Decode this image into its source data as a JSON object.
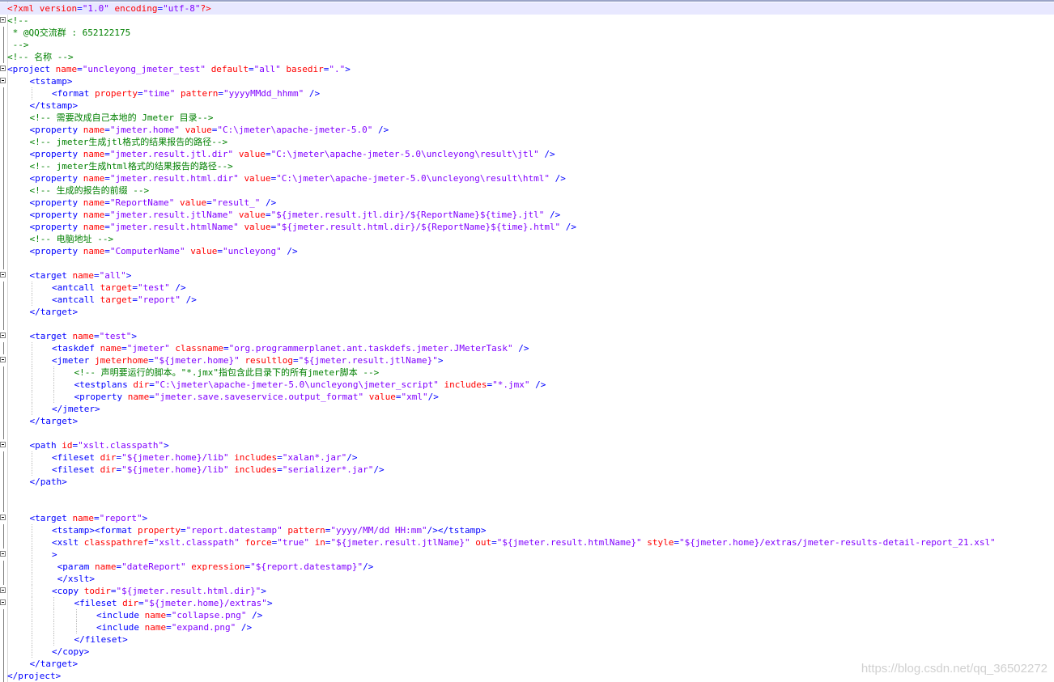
{
  "watermark": "https://blog.csdn.net/qq_36502272",
  "colors": {
    "tag": "#0000ff",
    "attr": "#ff0000",
    "value": "#8000ff",
    "comment": "#008000",
    "current_line": "#e8e8ff"
  },
  "lines": [
    {
      "indent": 0,
      "fold": false,
      "current": true,
      "tokens": [
        [
          "pi",
          "<?xml "
        ],
        [
          "attr",
          "version"
        ],
        [
          "tag",
          "="
        ],
        [
          "val",
          "\"1.0\""
        ],
        [
          "pi",
          " "
        ],
        [
          "attr",
          "encoding"
        ],
        [
          "tag",
          "="
        ],
        [
          "val",
          "\"utf-8\""
        ],
        [
          "pi",
          "?>"
        ]
      ]
    },
    {
      "indent": 0,
      "fold": true,
      "tokens": [
        [
          "cmt",
          "<!--"
        ]
      ]
    },
    {
      "indent": 0,
      "tokens": [
        [
          "cmt",
          " * @QQ交流群 : 652122175"
        ]
      ]
    },
    {
      "indent": 0,
      "tokens": [
        [
          "cmt",
          " -->"
        ]
      ]
    },
    {
      "indent": 0,
      "tokens": [
        [
          "cmt",
          "<!-- 名称 -->"
        ]
      ]
    },
    {
      "indent": 0,
      "fold": true,
      "tokens": [
        [
          "tag",
          "<project "
        ],
        [
          "attr",
          "name"
        ],
        [
          "tag",
          "="
        ],
        [
          "val",
          "\"uncleyong_jmeter_test\""
        ],
        [
          "tag",
          " "
        ],
        [
          "attr",
          "default"
        ],
        [
          "tag",
          "="
        ],
        [
          "val",
          "\"all\""
        ],
        [
          "tag",
          " "
        ],
        [
          "attr",
          "basedir"
        ],
        [
          "tag",
          "="
        ],
        [
          "val",
          "\".\""
        ],
        [
          "tag",
          ">"
        ]
      ]
    },
    {
      "indent": 1,
      "fold": true,
      "tokens": [
        [
          "tag",
          "<tstamp>"
        ]
      ]
    },
    {
      "indent": 2,
      "tokens": [
        [
          "tag",
          "<format "
        ],
        [
          "attr",
          "property"
        ],
        [
          "tag",
          "="
        ],
        [
          "val",
          "\"time\""
        ],
        [
          "tag",
          " "
        ],
        [
          "attr",
          "pattern"
        ],
        [
          "tag",
          "="
        ],
        [
          "val",
          "\"yyyyMMdd_hhmm\""
        ],
        [
          "tag",
          " />"
        ]
      ]
    },
    {
      "indent": 1,
      "tokens": [
        [
          "tag",
          "</tstamp>"
        ]
      ]
    },
    {
      "indent": 1,
      "tokens": [
        [
          "cmt",
          "<!-- 需要改成自己本地的 Jmeter 目录-->"
        ]
      ]
    },
    {
      "indent": 1,
      "tokens": [
        [
          "tag",
          "<property "
        ],
        [
          "attr",
          "name"
        ],
        [
          "tag",
          "="
        ],
        [
          "val",
          "\"jmeter.home\""
        ],
        [
          "tag",
          " "
        ],
        [
          "attr",
          "value"
        ],
        [
          "tag",
          "="
        ],
        [
          "val",
          "\"C:\\jmeter\\apache-jmeter-5.0\""
        ],
        [
          "tag",
          " />"
        ]
      ]
    },
    {
      "indent": 1,
      "tokens": [
        [
          "cmt",
          "<!-- jmeter生成jtl格式的结果报告的路径-->"
        ]
      ]
    },
    {
      "indent": 1,
      "tokens": [
        [
          "tag",
          "<property "
        ],
        [
          "attr",
          "name"
        ],
        [
          "tag",
          "="
        ],
        [
          "val",
          "\"jmeter.result.jtl.dir\""
        ],
        [
          "tag",
          " "
        ],
        [
          "attr",
          "value"
        ],
        [
          "tag",
          "="
        ],
        [
          "val",
          "\"C:\\jmeter\\apache-jmeter-5.0\\uncleyong\\result\\jtl\""
        ],
        [
          "tag",
          " />"
        ]
      ]
    },
    {
      "indent": 1,
      "tokens": [
        [
          "cmt",
          "<!-- jmeter生成html格式的结果报告的路径-->"
        ]
      ]
    },
    {
      "indent": 1,
      "tokens": [
        [
          "tag",
          "<property "
        ],
        [
          "attr",
          "name"
        ],
        [
          "tag",
          "="
        ],
        [
          "val",
          "\"jmeter.result.html.dir\""
        ],
        [
          "tag",
          " "
        ],
        [
          "attr",
          "value"
        ],
        [
          "tag",
          "="
        ],
        [
          "val",
          "\"C:\\jmeter\\apache-jmeter-5.0\\uncleyong\\result\\html\""
        ],
        [
          "tag",
          " />"
        ]
      ]
    },
    {
      "indent": 1,
      "tokens": [
        [
          "cmt",
          "<!-- 生成的报告的前缀 -->"
        ]
      ]
    },
    {
      "indent": 1,
      "tokens": [
        [
          "tag",
          "<property "
        ],
        [
          "attr",
          "name"
        ],
        [
          "tag",
          "="
        ],
        [
          "val",
          "\"ReportName\""
        ],
        [
          "tag",
          " "
        ],
        [
          "attr",
          "value"
        ],
        [
          "tag",
          "="
        ],
        [
          "val",
          "\"result_\""
        ],
        [
          "tag",
          " />"
        ]
      ]
    },
    {
      "indent": 1,
      "tokens": [
        [
          "tag",
          "<property "
        ],
        [
          "attr",
          "name"
        ],
        [
          "tag",
          "="
        ],
        [
          "val",
          "\"jmeter.result.jtlName\""
        ],
        [
          "tag",
          " "
        ],
        [
          "attr",
          "value"
        ],
        [
          "tag",
          "="
        ],
        [
          "val",
          "\"${jmeter.result.jtl.dir}/${ReportName}${time}.jtl\""
        ],
        [
          "tag",
          " />"
        ]
      ]
    },
    {
      "indent": 1,
      "tokens": [
        [
          "tag",
          "<property "
        ],
        [
          "attr",
          "name"
        ],
        [
          "tag",
          "="
        ],
        [
          "val",
          "\"jmeter.result.htmlName\""
        ],
        [
          "tag",
          " "
        ],
        [
          "attr",
          "value"
        ],
        [
          "tag",
          "="
        ],
        [
          "val",
          "\"${jmeter.result.html.dir}/${ReportName}${time}.html\""
        ],
        [
          "tag",
          " />"
        ]
      ]
    },
    {
      "indent": 1,
      "tokens": [
        [
          "cmt",
          "<!-- 电脑地址 -->"
        ]
      ]
    },
    {
      "indent": 1,
      "tokens": [
        [
          "tag",
          "<property "
        ],
        [
          "attr",
          "name"
        ],
        [
          "tag",
          "="
        ],
        [
          "val",
          "\"ComputerName\""
        ],
        [
          "tag",
          " "
        ],
        [
          "attr",
          "value"
        ],
        [
          "tag",
          "="
        ],
        [
          "val",
          "\"uncleyong\""
        ],
        [
          "tag",
          " />"
        ]
      ]
    },
    {
      "indent": 1,
      "tokens": []
    },
    {
      "indent": 1,
      "fold": true,
      "tokens": [
        [
          "tag",
          "<target "
        ],
        [
          "attr",
          "name"
        ],
        [
          "tag",
          "="
        ],
        [
          "val",
          "\"all\""
        ],
        [
          "tag",
          ">"
        ]
      ]
    },
    {
      "indent": 2,
      "tokens": [
        [
          "tag",
          "<antcall "
        ],
        [
          "attr",
          "target"
        ],
        [
          "tag",
          "="
        ],
        [
          "val",
          "\"test\""
        ],
        [
          "tag",
          " />"
        ]
      ]
    },
    {
      "indent": 2,
      "tokens": [
        [
          "tag",
          "<antcall "
        ],
        [
          "attr",
          "target"
        ],
        [
          "tag",
          "="
        ],
        [
          "val",
          "\"report\""
        ],
        [
          "tag",
          " />"
        ]
      ]
    },
    {
      "indent": 1,
      "tokens": [
        [
          "tag",
          "</target>"
        ]
      ]
    },
    {
      "indent": 1,
      "tokens": []
    },
    {
      "indent": 1,
      "fold": true,
      "tokens": [
        [
          "tag",
          "<target "
        ],
        [
          "attr",
          "name"
        ],
        [
          "tag",
          "="
        ],
        [
          "val",
          "\"test\""
        ],
        [
          "tag",
          ">"
        ]
      ]
    },
    {
      "indent": 2,
      "tokens": [
        [
          "tag",
          "<taskdef "
        ],
        [
          "attr",
          "name"
        ],
        [
          "tag",
          "="
        ],
        [
          "val",
          "\"jmeter\""
        ],
        [
          "tag",
          " "
        ],
        [
          "attr",
          "classname"
        ],
        [
          "tag",
          "="
        ],
        [
          "val",
          "\"org.programmerplanet.ant.taskdefs.jmeter.JMeterTask\""
        ],
        [
          "tag",
          " />"
        ]
      ]
    },
    {
      "indent": 2,
      "fold": true,
      "tokens": [
        [
          "tag",
          "<jmeter "
        ],
        [
          "attr",
          "jmeterhome"
        ],
        [
          "tag",
          "="
        ],
        [
          "val",
          "\"${jmeter.home}\""
        ],
        [
          "tag",
          " "
        ],
        [
          "attr",
          "resultlog"
        ],
        [
          "tag",
          "="
        ],
        [
          "val",
          "\"${jmeter.result.jtlName}\""
        ],
        [
          "tag",
          ">"
        ]
      ]
    },
    {
      "indent": 3,
      "tokens": [
        [
          "cmt",
          "<!-- 声明要运行的脚本。\"*.jmx\"指包含此目录下的所有jmeter脚本 -->"
        ]
      ]
    },
    {
      "indent": 3,
      "tokens": [
        [
          "tag",
          "<testplans "
        ],
        [
          "attr",
          "dir"
        ],
        [
          "tag",
          "="
        ],
        [
          "val",
          "\"C:\\jmeter\\apache-jmeter-5.0\\uncleyong\\jmeter_script\""
        ],
        [
          "tag",
          " "
        ],
        [
          "attr",
          "includes"
        ],
        [
          "tag",
          "="
        ],
        [
          "val",
          "\"*.jmx\""
        ],
        [
          "tag",
          " />"
        ]
      ]
    },
    {
      "indent": 3,
      "tokens": [
        [
          "tag",
          "<property "
        ],
        [
          "attr",
          "name"
        ],
        [
          "tag",
          "="
        ],
        [
          "val",
          "\"jmeter.save.saveservice.output_format\""
        ],
        [
          "tag",
          " "
        ],
        [
          "attr",
          "value"
        ],
        [
          "tag",
          "="
        ],
        [
          "val",
          "\"xml\""
        ],
        [
          "tag",
          "/>"
        ]
      ]
    },
    {
      "indent": 2,
      "tokens": [
        [
          "tag",
          "</jmeter>"
        ]
      ]
    },
    {
      "indent": 1,
      "tokens": [
        [
          "tag",
          "</target>"
        ]
      ]
    },
    {
      "indent": 1,
      "tokens": []
    },
    {
      "indent": 1,
      "fold": true,
      "tokens": [
        [
          "tag",
          "<path "
        ],
        [
          "attr",
          "id"
        ],
        [
          "tag",
          "="
        ],
        [
          "val",
          "\"xslt.classpath\""
        ],
        [
          "tag",
          ">"
        ]
      ]
    },
    {
      "indent": 2,
      "tokens": [
        [
          "tag",
          "<fileset "
        ],
        [
          "attr",
          "dir"
        ],
        [
          "tag",
          "="
        ],
        [
          "val",
          "\"${jmeter.home}/lib\""
        ],
        [
          "tag",
          " "
        ],
        [
          "attr",
          "includes"
        ],
        [
          "tag",
          "="
        ],
        [
          "val",
          "\"xalan*.jar\""
        ],
        [
          "tag",
          "/>"
        ]
      ]
    },
    {
      "indent": 2,
      "tokens": [
        [
          "tag",
          "<fileset "
        ],
        [
          "attr",
          "dir"
        ],
        [
          "tag",
          "="
        ],
        [
          "val",
          "\"${jmeter.home}/lib\""
        ],
        [
          "tag",
          " "
        ],
        [
          "attr",
          "includes"
        ],
        [
          "tag",
          "="
        ],
        [
          "val",
          "\"serializer*.jar\""
        ],
        [
          "tag",
          "/>"
        ]
      ]
    },
    {
      "indent": 1,
      "tokens": [
        [
          "tag",
          "</path>"
        ]
      ]
    },
    {
      "indent": 1,
      "tokens": []
    },
    {
      "indent": 1,
      "tokens": []
    },
    {
      "indent": 1,
      "fold": true,
      "tokens": [
        [
          "tag",
          "<target "
        ],
        [
          "attr",
          "name"
        ],
        [
          "tag",
          "="
        ],
        [
          "val",
          "\"report\""
        ],
        [
          "tag",
          ">"
        ]
      ]
    },
    {
      "indent": 2,
      "tokens": [
        [
          "tag",
          "<tstamp><format "
        ],
        [
          "attr",
          "property"
        ],
        [
          "tag",
          "="
        ],
        [
          "val",
          "\"report.datestamp\""
        ],
        [
          "tag",
          " "
        ],
        [
          "attr",
          "pattern"
        ],
        [
          "tag",
          "="
        ],
        [
          "val",
          "\"yyyy/MM/dd HH:mm\""
        ],
        [
          "tag",
          "/></tstamp>"
        ]
      ]
    },
    {
      "indent": 2,
      "tokens": [
        [
          "tag",
          "<xslt "
        ],
        [
          "attr",
          "classpathref"
        ],
        [
          "tag",
          "="
        ],
        [
          "val",
          "\"xslt.classpath\""
        ],
        [
          "tag",
          " "
        ],
        [
          "attr",
          "force"
        ],
        [
          "tag",
          "="
        ],
        [
          "val",
          "\"true\""
        ],
        [
          "tag",
          " "
        ],
        [
          "attr",
          "in"
        ],
        [
          "tag",
          "="
        ],
        [
          "val",
          "\"${jmeter.result.jtlName}\""
        ],
        [
          "tag",
          " "
        ],
        [
          "attr",
          "out"
        ],
        [
          "tag",
          "="
        ],
        [
          "val",
          "\"${jmeter.result.htmlName}\""
        ],
        [
          "tag",
          " "
        ],
        [
          "attr",
          "style"
        ],
        [
          "tag",
          "="
        ],
        [
          "val",
          "\"${jmeter.home}/extras/jmeter-results-detail-report_21.xsl\""
        ]
      ]
    },
    {
      "indent": 2,
      "fold": true,
      "tokens": [
        [
          "tag",
          ">"
        ]
      ]
    },
    {
      "indent": 2,
      "tokens": [
        [
          "tag",
          " <param "
        ],
        [
          "attr",
          "name"
        ],
        [
          "tag",
          "="
        ],
        [
          "val",
          "\"dateReport\""
        ],
        [
          "tag",
          " "
        ],
        [
          "attr",
          "expression"
        ],
        [
          "tag",
          "="
        ],
        [
          "val",
          "\"${report.datestamp}\""
        ],
        [
          "tag",
          "/>"
        ]
      ]
    },
    {
      "indent": 2,
      "tokens": [
        [
          "tag",
          " </xslt>"
        ]
      ]
    },
    {
      "indent": 2,
      "fold": true,
      "tokens": [
        [
          "tag",
          "<copy "
        ],
        [
          "attr",
          "todir"
        ],
        [
          "tag",
          "="
        ],
        [
          "val",
          "\"${jmeter.result.html.dir}\""
        ],
        [
          "tag",
          ">"
        ]
      ]
    },
    {
      "indent": 3,
      "fold": true,
      "tokens": [
        [
          "tag",
          "<fileset "
        ],
        [
          "attr",
          "dir"
        ],
        [
          "tag",
          "="
        ],
        [
          "val",
          "\"${jmeter.home}/extras\""
        ],
        [
          "tag",
          ">"
        ]
      ]
    },
    {
      "indent": 4,
      "tokens": [
        [
          "tag",
          "<include "
        ],
        [
          "attr",
          "name"
        ],
        [
          "tag",
          "="
        ],
        [
          "val",
          "\"collapse.png\""
        ],
        [
          "tag",
          " />"
        ]
      ]
    },
    {
      "indent": 4,
      "tokens": [
        [
          "tag",
          "<include "
        ],
        [
          "attr",
          "name"
        ],
        [
          "tag",
          "="
        ],
        [
          "val",
          "\"expand.png\""
        ],
        [
          "tag",
          " />"
        ]
      ]
    },
    {
      "indent": 3,
      "tokens": [
        [
          "tag",
          "</fileset>"
        ]
      ]
    },
    {
      "indent": 2,
      "tokens": [
        [
          "tag",
          "</copy>"
        ]
      ]
    },
    {
      "indent": 1,
      "tokens": [
        [
          "tag",
          "</target>"
        ]
      ]
    },
    {
      "indent": 0,
      "tokens": [
        [
          "tag",
          "</project>"
        ]
      ]
    }
  ]
}
